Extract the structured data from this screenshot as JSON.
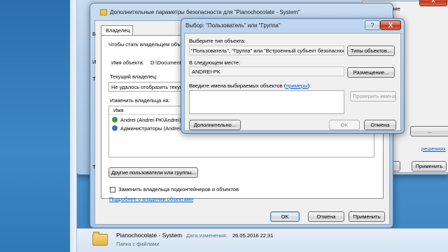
{
  "bg_window": {
    "top_right_text_1": "изменение",
    "top_right_text_2": "а",
    "btn_additional_partial": "...",
    "link_partial": "решениях",
    "btn_ok_partial": "...",
    "btn_cancel_partial": "Отмена",
    "btn_apply": "Применить"
  },
  "security_dialog": {
    "title": "Дополнительные параметры безопасности  для \"Pianochocolate - System\"",
    "tab_owner": "Владелец",
    "hint": "Чтобы стать владельцем объекта...",
    "object_name_label": "Имя объекта:",
    "object_name_value": "D:\\Documents",
    "current_owner_label": "Текущий владелец:",
    "current_owner_value": "Не удалось отобразить текущ...",
    "change_owner_label": "Изменить владельца на:",
    "list_header": "Имя",
    "owners": [
      "Andrei (Andrei-PK\\Andrei)",
      "Администраторы (Andrei-PK..."
    ],
    "other_users_button": "Другие пользователи или группы...",
    "replace_owner_checkbox": "Заменить владельца подконтейнеров и объектов",
    "more_info_link": "Подробнее о владении объектами",
    "ok": "OK",
    "cancel": "Отмена",
    "apply": "Применить",
    "left_edge_letters": [
      "Б",
      "И",
      "Т",
      "Т",
      "Т"
    ]
  },
  "select_dialog": {
    "title": "Выбор: \"Пользователь\" или \"Группа\"",
    "help_button": "?",
    "close_button": "X",
    "object_type_label": "Выберите тип объекта:",
    "object_type_value": "\"Пользователь\", \"Группа\" или \"Встроенный субъект безопасност",
    "object_types_button": "Типы объектов...",
    "location_label": "В следующем месте:",
    "location_value": "ANDREI-PK",
    "location_button": "Размещение...",
    "enter_names_label": "Введите имена выбираемых объектов (",
    "examples_link": "примеры",
    "enter_names_label_end": "):",
    "names_value": "",
    "check_names_button": "Проверить имена",
    "advanced_button": "Дополнительно...",
    "ok": "OK",
    "cancel": "Отмена"
  },
  "details_pane": {
    "name": "Pianochocolate - System",
    "modified_label": "Дата изменения:",
    "modified_value": "26.05.2016 22:31",
    "type": "Папка с файлами"
  }
}
